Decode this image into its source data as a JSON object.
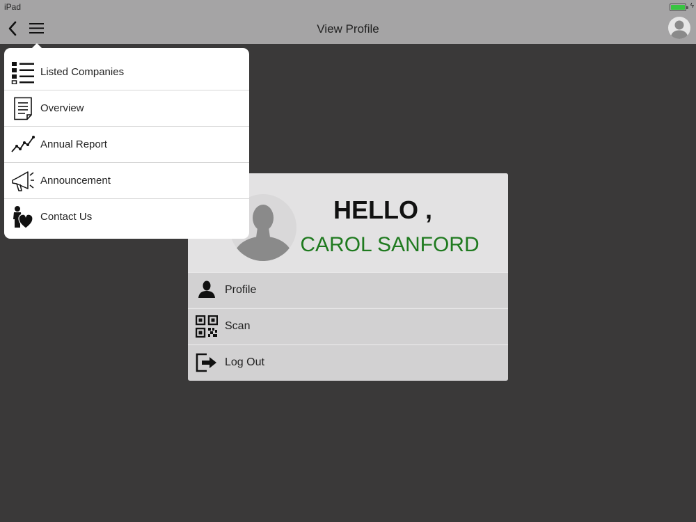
{
  "status_bar": {
    "device": "iPad"
  },
  "nav": {
    "title": "View Profile"
  },
  "menu": {
    "items": [
      {
        "label": "Listed Companies",
        "icon": "list-icon"
      },
      {
        "label": "Overview",
        "icon": "document-icon"
      },
      {
        "label": "Annual Report",
        "icon": "trend-chart-icon"
      },
      {
        "label": "Announcement",
        "icon": "megaphone-icon"
      },
      {
        "label": "Contact Us",
        "icon": "contact-heart-icon"
      }
    ]
  },
  "profile_card": {
    "greeting": "HELLO ,",
    "name": "CAROL SANFORD",
    "items": [
      {
        "label": "Profile",
        "icon": "person-icon"
      },
      {
        "label": "Scan",
        "icon": "qr-code-icon"
      },
      {
        "label": "Log Out",
        "icon": "logout-icon"
      }
    ]
  },
  "colors": {
    "background": "#3a3939",
    "bar": "#a5a4a5",
    "name_green": "#1f7a1f",
    "battery_green": "#38c441"
  }
}
